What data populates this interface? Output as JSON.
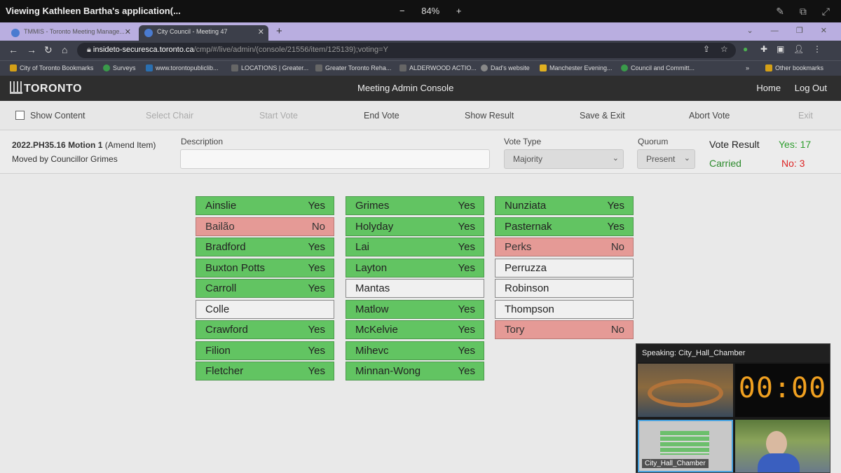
{
  "share": {
    "title": "Viewing Kathleen Bartha's application(...",
    "zoom": "84%",
    "zoom_minus": "−",
    "zoom_plus": "+"
  },
  "browser": {
    "tabs": [
      {
        "label": "TMMIS - Toronto Meeting Manage...",
        "active": false
      },
      {
        "label": "City Council - Meeting 47",
        "active": true
      }
    ],
    "url_host": "insideto-securesca.toronto.ca",
    "url_path": "/cmp/#/live/admin/(console/21556/item/125139);voting=Y",
    "bookmarks": [
      "City of Toronto Bookmarks",
      "Surveys",
      "www.torontopubliclib...",
      "LOCATIONS | Greater...",
      "Greater Toronto Reha...",
      "ALDERWOOD ACTIO...",
      "Dad's website",
      "Manchester Evening...",
      "Council and Committ...",
      "»",
      "Other bookmarks"
    ]
  },
  "app": {
    "logo": "TORONTO",
    "title": "Meeting Admin Console",
    "nav": [
      "Home",
      "Log Out"
    ]
  },
  "actions": {
    "show_content": "Show Content",
    "select_chair": "Select Chair",
    "start_vote": "Start Vote",
    "end_vote": "End Vote",
    "show_result": "Show Result",
    "save_exit": "Save & Exit",
    "abort_vote": "Abort Vote",
    "exit": "Exit"
  },
  "motion": {
    "id": "2022.PH35.16 Motion 1",
    "type": "(Amend Item)",
    "moved_by": "Moved by Councillor Grimes",
    "description_label": "Description",
    "description_value": "",
    "vote_type_label": "Vote Type",
    "vote_type_value": "Majority",
    "quorum_label": "Quorum",
    "quorum_value": "Present"
  },
  "result": {
    "label": "Vote Result",
    "status": "Carried",
    "yes": "Yes: 17",
    "no": "No: 3"
  },
  "votes": {
    "col1": [
      {
        "name": "Ainslie",
        "vote": "Yes"
      },
      {
        "name": "Bailão",
        "vote": "No"
      },
      {
        "name": "Bradford",
        "vote": "Yes"
      },
      {
        "name": "Buxton Potts",
        "vote": "Yes"
      },
      {
        "name": "Carroll",
        "vote": "Yes"
      },
      {
        "name": "Colle",
        "vote": ""
      },
      {
        "name": "Crawford",
        "vote": "Yes"
      },
      {
        "name": "Filion",
        "vote": "Yes"
      },
      {
        "name": "Fletcher",
        "vote": "Yes"
      }
    ],
    "col2": [
      {
        "name": "Grimes",
        "vote": "Yes"
      },
      {
        "name": "Holyday",
        "vote": "Yes"
      },
      {
        "name": "Lai",
        "vote": "Yes"
      },
      {
        "name": "Layton",
        "vote": "Yes"
      },
      {
        "name": "Mantas",
        "vote": ""
      },
      {
        "name": "Matlow",
        "vote": "Yes"
      },
      {
        "name": "McKelvie",
        "vote": "Yes"
      },
      {
        "name": "Mihevc",
        "vote": "Yes"
      },
      {
        "name": "Minnan-Wong",
        "vote": "Yes"
      }
    ],
    "col3": [
      {
        "name": "Nunziata",
        "vote": "Yes"
      },
      {
        "name": "Pasternak",
        "vote": "Yes"
      },
      {
        "name": "Perks",
        "vote": "No"
      },
      {
        "name": "Perruzza",
        "vote": ""
      },
      {
        "name": "Robinson",
        "vote": ""
      },
      {
        "name": "Thompson",
        "vote": ""
      },
      {
        "name": "Tory",
        "vote": "No"
      }
    ]
  },
  "video": {
    "speaking": "Speaking: City_Hall_Chamber",
    "timer": "00:00",
    "caption": "City_Hall_Chamber"
  }
}
